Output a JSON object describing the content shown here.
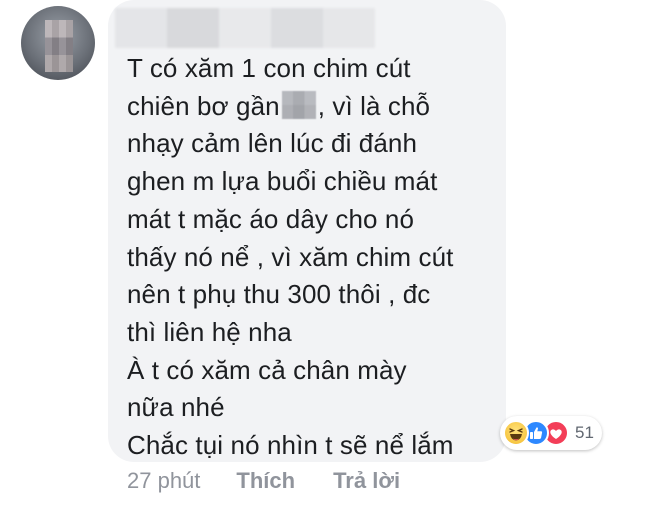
{
  "comment": {
    "lines_before_censor": "T có xăm 1 con chim cút",
    "line2_prefix": "chiên bơ gần",
    "line2_suffix": ", vì là chỗ",
    "lines": [
      "nhạy cảm lên lúc đi đánh",
      "ghen m lựa buổi chiều mát",
      "mát t mặc áo dây cho nó",
      "thấy nó nể , vì xăm chim cút",
      "nên t phụ thu 300 thôi , đc",
      "thì liên hệ nha",
      "À t có xăm cả chân mày",
      "nữa nhé",
      "Chắc tụi nó nhìn t sẽ nể lắm"
    ]
  },
  "reactions": {
    "icons": [
      "haha-icon",
      "like-icon",
      "love-icon"
    ],
    "count": "51",
    "colors": {
      "haha": "#f7c744",
      "like": "#2d88ff",
      "love": "#f33e58"
    }
  },
  "meta": {
    "time": "27 phút",
    "like_label": "Thích",
    "reply_label": "Trả lời"
  },
  "colors": {
    "bubble": "#f2f3f5",
    "text": "#1c1e21",
    "meta": "#90949c"
  }
}
